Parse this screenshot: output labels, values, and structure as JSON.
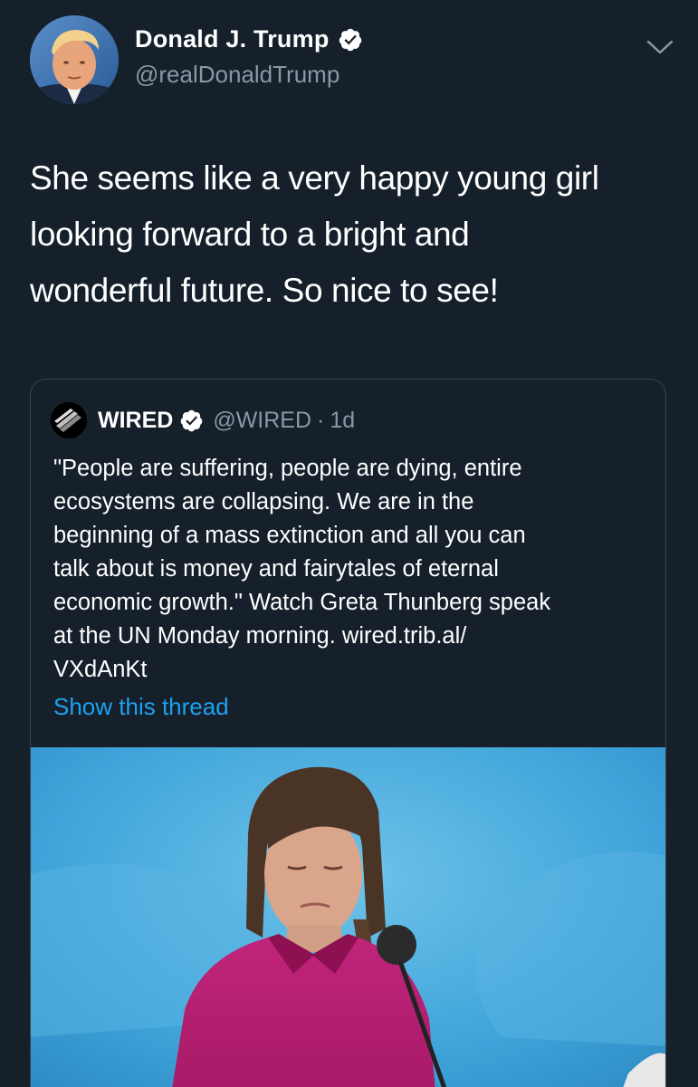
{
  "tweet": {
    "author_name": "Donald J. Trump",
    "handle": "@realDonaldTrump",
    "verified_icon": "verified-badge",
    "menu_icon": "chevron-down-icon",
    "text_lines": [
      "She seems like a very happy young girl",
      "looking forward to a bright and",
      "wonderful future. So nice to see!"
    ]
  },
  "quoted_tweet": {
    "author_name": "WIRED",
    "handle": "@WIRED",
    "separator": "·",
    "time": "1d",
    "body_lines": [
      "\"People are suffering, people are dying, entire",
      "ecosystems are collapsing. We are in the",
      "beginning of a mass extinction and all you can",
      "talk about is money and fairytales of eternal",
      "economic growth.\" Watch Greta Thunberg speak",
      "at the UN Monday morning. wired.trib.al/",
      "VXdAnKt"
    ],
    "show_thread": "Show this thread"
  },
  "colors": {
    "background": "#15202b",
    "text_primary": "#ffffff",
    "text_secondary": "#8899a6",
    "link": "#1da1f2",
    "verified": "#ffffff",
    "border": "#38444d"
  }
}
